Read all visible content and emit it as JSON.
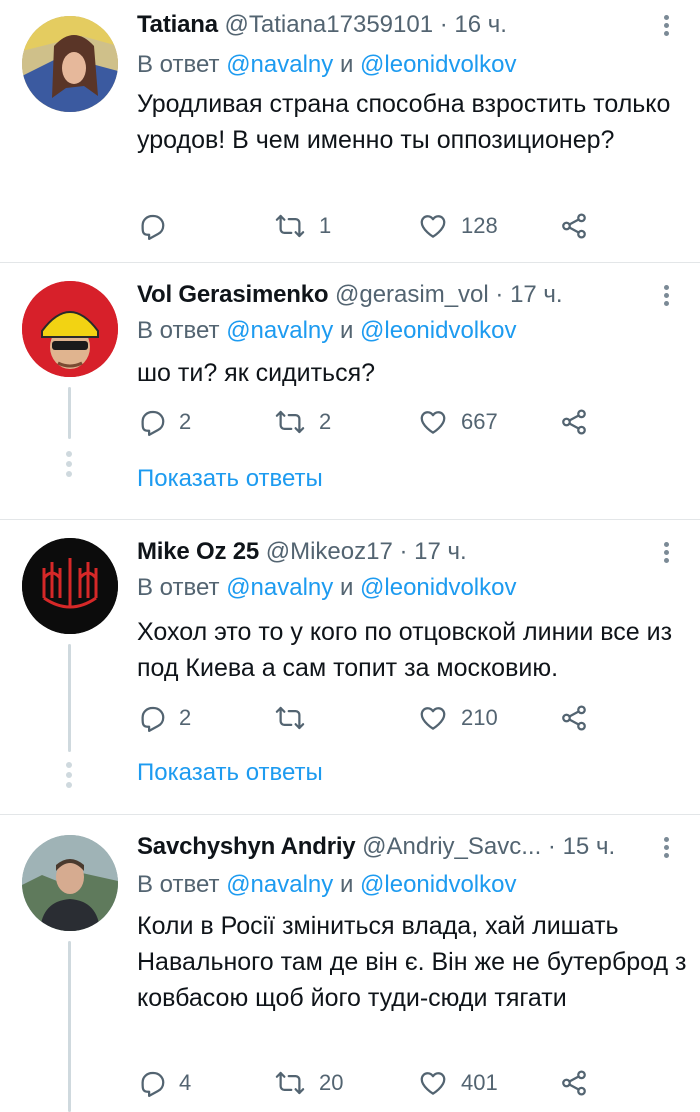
{
  "reply_prefix": "В ответ",
  "reply_and": "и",
  "show_replies_label": "Показать ответы",
  "colors": {
    "accent": "#1d9bf0",
    "secondary_text": "#536471",
    "divider": "#e3e6e8"
  },
  "tweets": [
    {
      "name": "Tatiana",
      "handle": "@Tatiana17359101",
      "time": "· 16 ч.",
      "mentions": [
        "@navalny",
        "@leonidvolkov"
      ],
      "text": "Уродливая страна способна взростить только уродов! В чем именно ты оппозиционер?",
      "replies": "",
      "retweets": "1",
      "likes": "128"
    },
    {
      "name": "Vol Gerasimenko",
      "handle": "@gerasim_vol",
      "time": "· 17 ч.",
      "mentions": [
        "@navalny",
        "@leonidvolkov"
      ],
      "text": "шо ти? як сидиться?",
      "replies": "2",
      "retweets": "2",
      "likes": "667"
    },
    {
      "name": "Mike Oz 25",
      "handle": "@Mikeoz17",
      "time": "· 17 ч.",
      "mentions": [
        "@navalny",
        "@leonidvolkov"
      ],
      "text": "Хохол это то у кого по отцовской линии все из под Киева а сам топит за московию.",
      "replies": "2",
      "retweets": "",
      "likes": "210"
    },
    {
      "name": "Savchyshyn Andriy",
      "handle": "@Andriy_Savc...",
      "time": "· 15 ч.",
      "mentions": [
        "@navalny",
        "@leonidvolkov"
      ],
      "text": "Коли в Росії зміниться влада, хай лишать Навального там де він є. Він же не бутерброд з ковбасою щоб його туди-сюди тягати",
      "replies": "4",
      "retweets": "20",
      "likes": "401"
    }
  ]
}
